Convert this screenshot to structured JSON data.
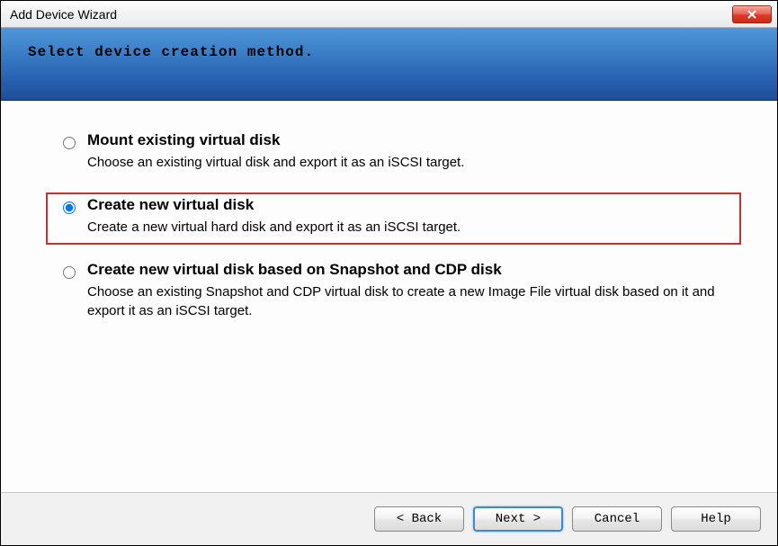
{
  "window": {
    "title": "Add Device Wizard"
  },
  "banner": {
    "text": "Select device creation method."
  },
  "options": [
    {
      "title": "Mount existing virtual disk",
      "desc": "Choose an existing virtual disk and export it as an iSCSI target.",
      "selected": false,
      "highlighted": false
    },
    {
      "title": "Create new virtual disk",
      "desc": "Create a new virtual hard disk and export it as an iSCSI target.",
      "selected": true,
      "highlighted": true
    },
    {
      "title": "Create new virtual disk based on Snapshot and CDP disk",
      "desc": "Choose an existing Snapshot and CDP virtual disk to create a new Image File virtual disk based on it and export it as an iSCSI target.",
      "selected": false,
      "highlighted": false
    }
  ],
  "buttons": {
    "back": "< Back",
    "next": "Next >",
    "cancel": "Cancel",
    "help": "Help"
  }
}
